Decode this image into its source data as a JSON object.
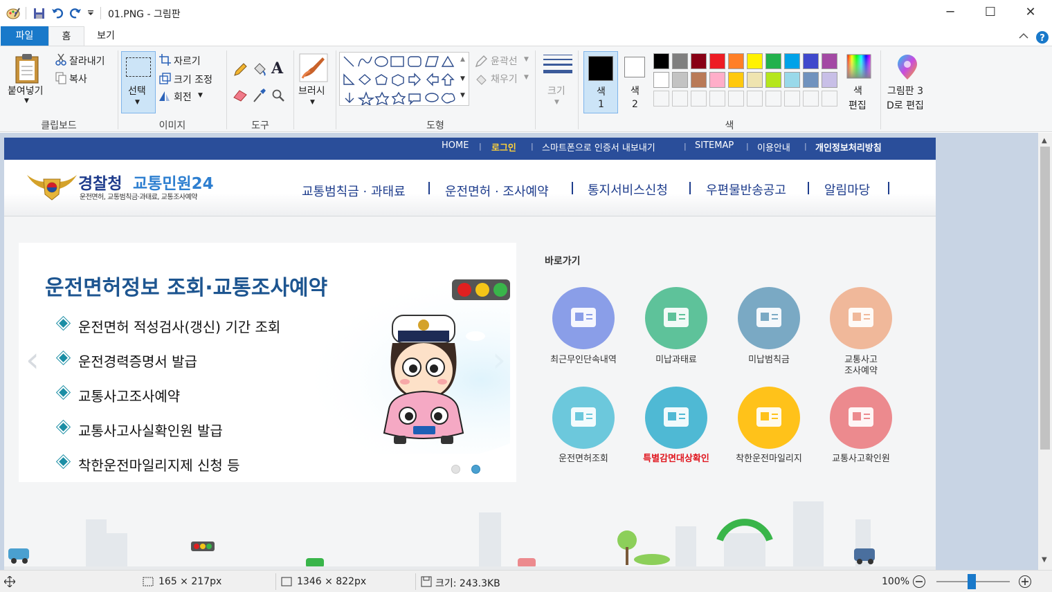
{
  "window": {
    "title": "01.PNG - 그림판",
    "minimize_glyph": "─",
    "maximize_glyph": "☐",
    "close_glyph": "✕"
  },
  "tabs": {
    "file": "파일",
    "home": "홈",
    "view": "보기"
  },
  "ribbon": {
    "clipboard": {
      "paste": "붙여넣기",
      "cut": "잘라내기",
      "copy": "복사",
      "group": "클립보드"
    },
    "image": {
      "select": "선택",
      "crop": "자르기",
      "resize": "크기 조정",
      "rotate": "회전",
      "group": "이미지"
    },
    "tools": {
      "group": "도구"
    },
    "brushes": {
      "label": "브러시"
    },
    "shapes": {
      "outline": "윤곽선",
      "fill": "채우기",
      "group": "도형"
    },
    "size": {
      "label": "크기"
    },
    "colors": {
      "color1": "색",
      "color1_num": "1",
      "color2": "색",
      "color2_num": "2",
      "edit": "색",
      "edit2": "편집",
      "paint3d_line1": "그림판 3",
      "paint3d_line2": "D로 편집",
      "group": "색",
      "palette_row1": [
        "#000000",
        "#7f7f7f",
        "#880015",
        "#ed1c24",
        "#ff7f27",
        "#fff200",
        "#22b14c",
        "#00a2e8",
        "#3f48cc",
        "#a349a4"
      ],
      "palette_row2": [
        "#ffffff",
        "#c3c3c3",
        "#b97a57",
        "#ffaec9",
        "#ffc90e",
        "#efe4b0",
        "#b5e61d",
        "#99d9ea",
        "#7092be",
        "#c8bfe7"
      ]
    }
  },
  "site": {
    "topnav": [
      "HOME",
      "로그인",
      "스마트폰으로 인증서 내보내기",
      "SITEMAP",
      "이용안내",
      "개인정보처리방침"
    ],
    "topnav_sep": "|",
    "logo_main": "경찰청",
    "logo_sub": "교통민원24",
    "logo_tagline": "운전면허, 교통범칙금·과태료, 교통조사예약",
    "gnb": [
      "교통범칙금 · 과태료",
      "운전면허 · 조사예약",
      "통지서비스신청",
      "우편물반송공고",
      "알림마당"
    ],
    "banner": {
      "title": "운전면허정보 조회·교통조사예약",
      "items": [
        "운전면허 적성검사(갱신) 기간 조회",
        "운전경력증명서 발급",
        "교통사고조사예약",
        "교통사고사실확인원 발급",
        "착한운전마일리지제 신청 등"
      ],
      "prev": "‹",
      "next": "›"
    },
    "quick": {
      "title": "바로가기",
      "items": [
        {
          "label": "최근무인단속내역",
          "color": "#8a9ee8"
        },
        {
          "label": "미납과태료",
          "color": "#5ec29a"
        },
        {
          "label": "미납범칙금",
          "color": "#7aa9c4"
        },
        {
          "label": "교통사고\n조사예약",
          "color": "#f0b89a"
        },
        {
          "label": "운전면허조회",
          "color": "#6cc8dc"
        },
        {
          "label": "특별감면대상확인",
          "color": "#4fb9d4"
        },
        {
          "label": "착한운전마일리지",
          "color": "#ffc21a"
        },
        {
          "label": "교통사고확인원",
          "color": "#ec8a8e"
        }
      ]
    }
  },
  "status": {
    "cursor_pos": "165 × 217px",
    "image_size": "1346 × 822px",
    "file_size": "크기: 243.3KB",
    "zoom": "100%",
    "zoom_level": 1.0
  }
}
